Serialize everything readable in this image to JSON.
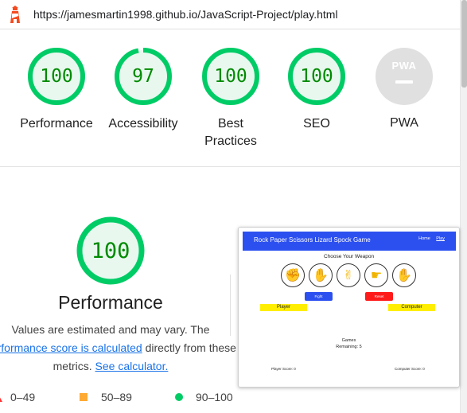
{
  "url_bar": {
    "url": "https://jamesmartin1998.github.io/JavaScript-Project/play.html",
    "icon": "lighthouse-icon"
  },
  "colors": {
    "pass": "#0c6",
    "pass_text": "#008a00",
    "average": "#fa3",
    "fail": "#f33",
    "link": "#1a73e8",
    "pwa_grey": "#e0e0e0"
  },
  "gauges": [
    {
      "score": "100",
      "label": "Performance"
    },
    {
      "score": "97",
      "label": "Accessibility"
    },
    {
      "score": "100",
      "label": "Best Practices",
      "label_lines": [
        "Best",
        "Practices"
      ]
    },
    {
      "score": "100",
      "label": "SEO"
    },
    {
      "badge_text": "PWA",
      "label": "PWA"
    }
  ],
  "performance": {
    "score": "100",
    "title": "Performance",
    "desc_line1": "Values are estimated and may vary. The",
    "desc_link": "performance score is calculated",
    "desc_after_link": " directly from these",
    "desc_line3": "metrics. ",
    "calculator_link": "See calculator."
  },
  "legend": [
    {
      "range": "0–49",
      "marker": "triangle"
    },
    {
      "range": "50–89",
      "marker": "square"
    },
    {
      "range": "90–100",
      "marker": "circle"
    }
  ],
  "screenshot": {
    "nav_title": "Rock Paper Scissors Lizard Spock Game",
    "nav_links": [
      "Home",
      "Play"
    ],
    "choose_text": "Choose Your Weapon",
    "weapons": [
      "fist-rock-icon",
      "hand-paper-icon",
      "hand-scissors-icon",
      "hand-lizard-icon",
      "hand-spock-icon"
    ],
    "fight_label": "Fight",
    "reset_label": "Reset",
    "player_label": "Player",
    "computer_label": "Computer",
    "games_line1": "Games",
    "games_line2": "Remaining: 5",
    "player_score": "Player Score: 0",
    "computer_score": "Computer Score: 0"
  }
}
